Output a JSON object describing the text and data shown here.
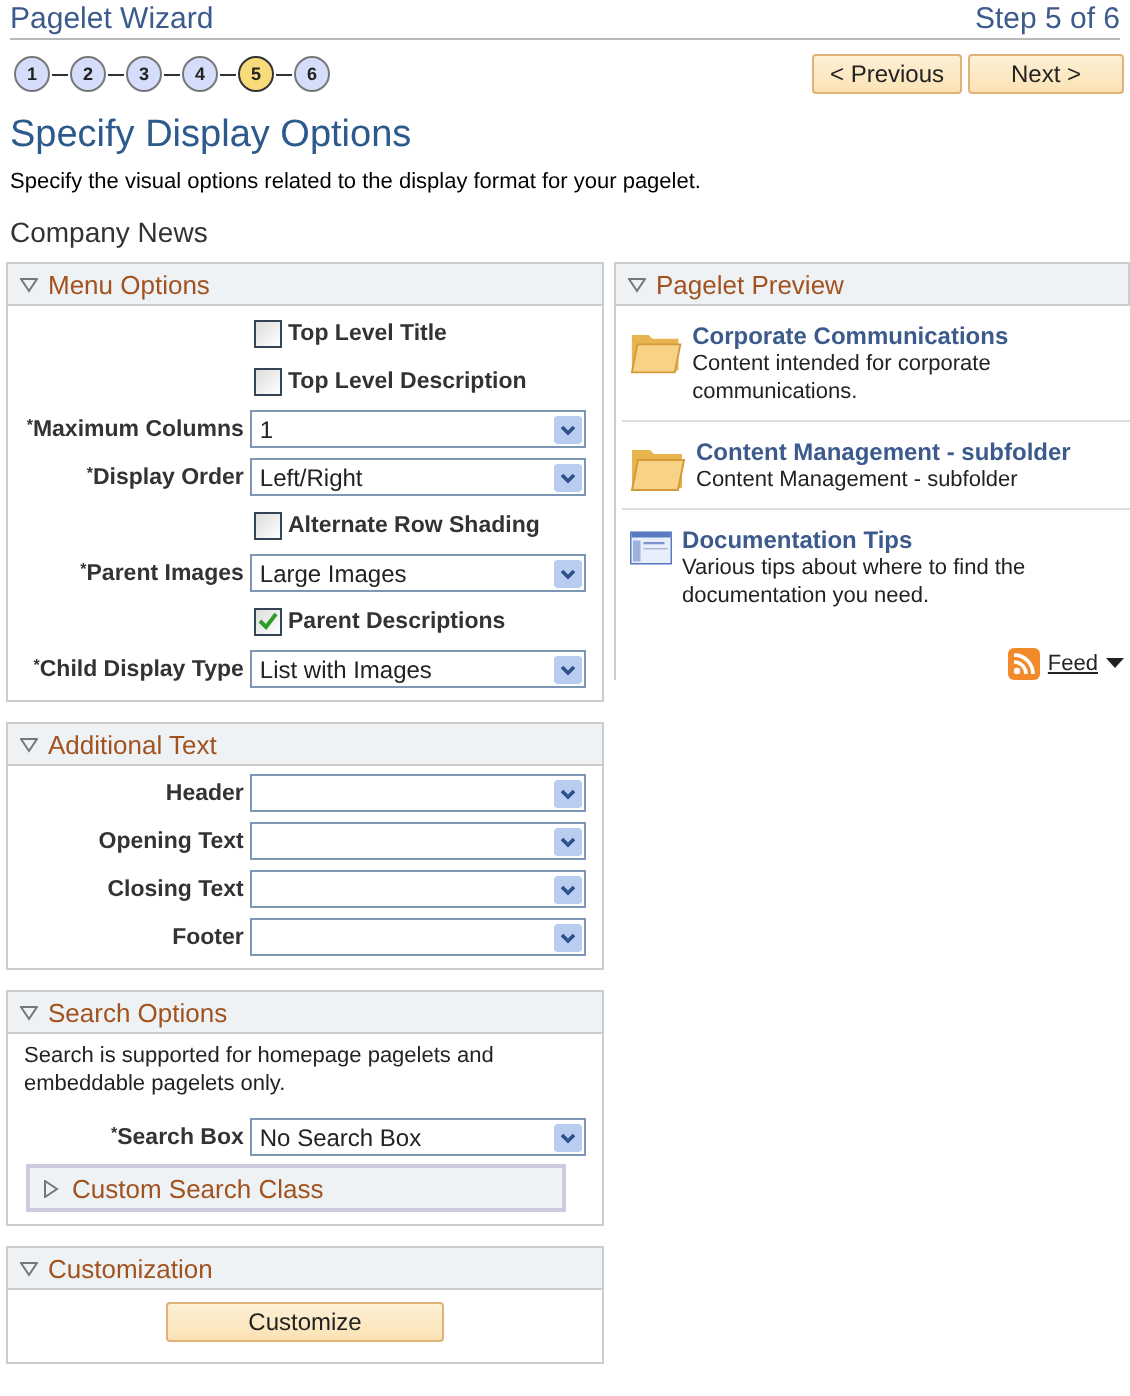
{
  "header": {
    "title": "Pagelet Wizard",
    "step_text": "Step 5 of 6"
  },
  "steps": [
    {
      "label": "1",
      "selected": false
    },
    {
      "label": "2",
      "selected": false
    },
    {
      "label": "3",
      "selected": false
    },
    {
      "label": "4",
      "selected": false
    },
    {
      "label": "5",
      "selected": true
    },
    {
      "label": "6",
      "selected": false
    }
  ],
  "nav_buttons": [
    "< Previous",
    "Next >"
  ],
  "page_title": "Specify Display Options",
  "instructions": "Specify the visual options related to the display format for your pagelet.",
  "pagelet_name": "Company News",
  "menu_options": {
    "title": "Menu Options",
    "expanded": true,
    "rows": [
      {
        "kind": "checkbox",
        "label": "Top Level Title",
        "checked": false
      },
      {
        "kind": "checkbox",
        "label": "Top Level Description",
        "checked": false
      },
      {
        "kind": "select",
        "label": "$^{*}$Maximum Columns",
        "value": "1"
      },
      {
        "kind": "select",
        "label": "$^{*}$Display Order",
        "value": "Left/Right"
      },
      {
        "kind": "checkbox",
        "label": "Alternate Row Shading",
        "checked": false
      },
      {
        "kind": "select",
        "label": "$^{*}$Parent Images",
        "value": "Large Images"
      },
      {
        "kind": "checkbox",
        "label": "Parent Descriptions",
        "checked": true
      },
      {
        "kind": "select",
        "label": "$^{*}$Child Display Type",
        "value": "List with Images"
      }
    ]
  },
  "additional_text": {
    "title": "Additional Text",
    "expanded": true,
    "rows": [
      {
        "kind": "select",
        "label": "Header"
      },
      {
        "kind": "select",
        "label": "Opening Text"
      },
      {
        "kind": "select",
        "label": "Closing Text"
      },
      {
        "kind": "select",
        "label": "Footer"
      }
    ]
  },
  "search_options": {
    "title": "Search Options",
    "expanded": true,
    "note": "Search is supported for homepage pagelets and embeddable pagelets only.",
    "rows": [
      {
        "kind": "select",
        "label": "$^{*}$Search Box",
        "value": "No Search Box"
      }
    ],
    "subsection": {
      "title": "Custom Search Class",
      "expanded": false
    }
  },
  "customization": {
    "title": "Customization",
    "expanded": true,
    "button": "Customize"
  },
  "preview": {
    "title": "Pagelet Preview",
    "expanded": true,
    "items": [
      {
        "kind": "folder",
        "title": "Corporate Communications",
        "description": "Content intended for corporate communications."
      },
      {
        "kind": "folder",
        "title": "Content Management - subfolder",
        "description": "Content Management - subfolder"
      },
      {
        "kind": "document",
        "title": "Documentation Tips",
        "description": "Various tips about where to find the documentation you need."
      }
    ],
    "feed": "Feed"
  }
}
